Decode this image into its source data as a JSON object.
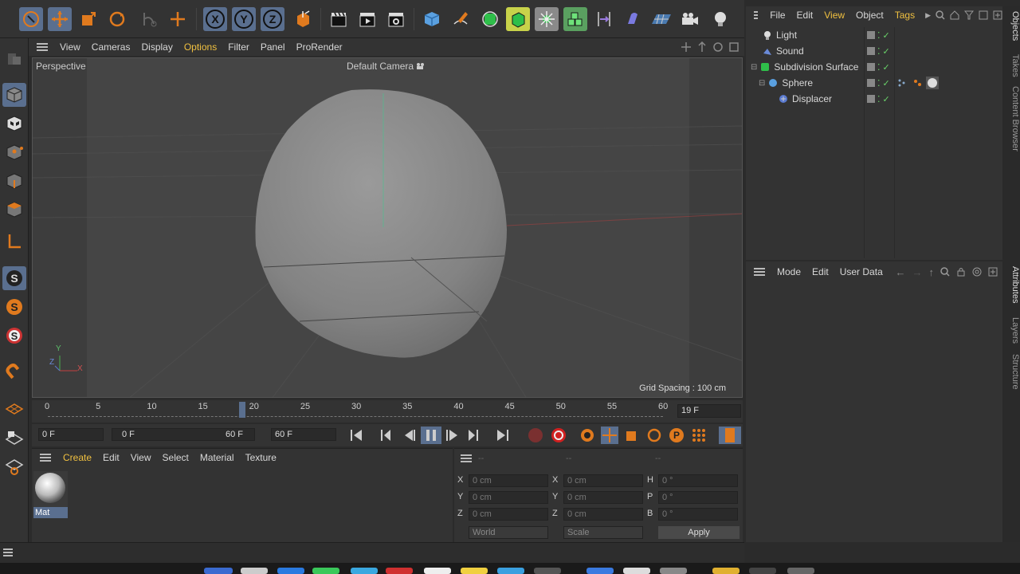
{
  "viewport_menu": [
    "View",
    "Cameras",
    "Display",
    "Options",
    "Filter",
    "Panel",
    "ProRender"
  ],
  "viewport": {
    "projection_label": "Perspective",
    "camera_label": "Default Camera",
    "grid_spacing": "Grid Spacing : 100 cm",
    "axis_y": "Y",
    "axis_z": "Z",
    "axis_x": "X"
  },
  "timeline": {
    "ticks": [
      "0",
      "5",
      "10",
      "15",
      "20",
      "25",
      "30",
      "35",
      "40",
      "45",
      "50",
      "55",
      "60"
    ],
    "current_frame": "19 F",
    "playhead_frame": 19,
    "max_frame": 60
  },
  "transport": {
    "start_field": "0 F",
    "range_start": "0 F",
    "range_end": "60 F",
    "end_field": "60 F"
  },
  "material_manager": {
    "menu": [
      "Create",
      "Edit",
      "View",
      "Select",
      "Material",
      "Texture"
    ],
    "materials": [
      {
        "name": "Mat"
      }
    ]
  },
  "coordinates": {
    "headers": [
      "--",
      "--",
      "--"
    ],
    "rows": [
      {
        "a": "X",
        "av": "0 cm",
        "b": "X",
        "bv": "0 cm",
        "c": "H",
        "cv": "0 °"
      },
      {
        "a": "Y",
        "av": "0 cm",
        "b": "Y",
        "bv": "0 cm",
        "c": "P",
        "cv": "0 °"
      },
      {
        "a": "Z",
        "av": "0 cm",
        "b": "Z",
        "bv": "0 cm",
        "c": "B",
        "cv": "0 °"
      }
    ],
    "mode_select": "World",
    "scale_select": "Scale",
    "apply_label": "Apply"
  },
  "object_manager": {
    "menu": [
      "File",
      "Edit",
      "View",
      "Object",
      "Tags"
    ],
    "objects": [
      {
        "name": "Light",
        "indent": 0
      },
      {
        "name": "Sound",
        "indent": 0
      },
      {
        "name": "Subdivision Surface",
        "indent": 0
      },
      {
        "name": "Sphere",
        "indent": 1
      },
      {
        "name": "Displacer",
        "indent": 2
      }
    ]
  },
  "attribute_manager": {
    "menu": [
      "Mode",
      "Edit",
      "User Data"
    ]
  },
  "right_tabs": [
    "Objects",
    "Takes",
    "Content Browser",
    "Attributes",
    "Layers",
    "Structure"
  ],
  "colors": {
    "accent": "#f0c040",
    "active_button": "#5a6f8f",
    "check_green": "#6ad46a"
  }
}
